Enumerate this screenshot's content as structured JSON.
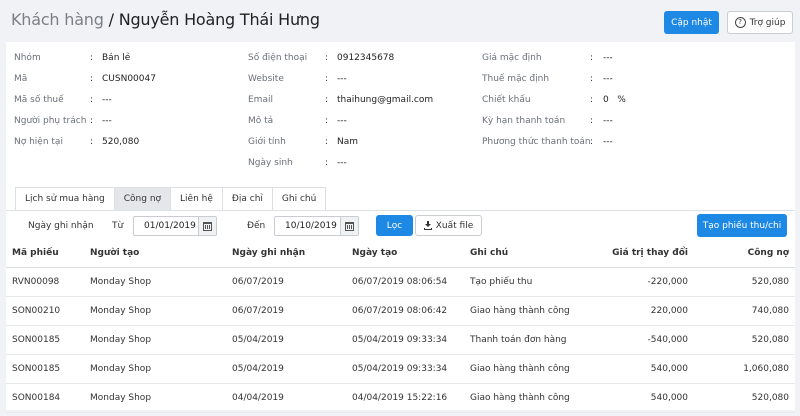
{
  "header": {
    "breadcrumb": "Khách hàng",
    "separator": " / ",
    "customer_name": "Nguyễn Hoàng Thái Hưng",
    "update_label": "Cập nhật",
    "help_label": "Trợ giúp"
  },
  "info": {
    "col1": [
      {
        "label": "Nhóm",
        "value": "Bán lẻ"
      },
      {
        "label": "Mã",
        "value": "CUSN00047"
      },
      {
        "label": "Mã số thuế",
        "value": "---"
      },
      {
        "label": "Người phụ trách",
        "value": "---"
      },
      {
        "label": "Nợ hiện tại",
        "value": "520,080"
      }
    ],
    "col2": [
      {
        "label": "Số điện thoại",
        "value": "0912345678"
      },
      {
        "label": "Website",
        "value": "---"
      },
      {
        "label": "Email",
        "value": "thaihung@gmail.com"
      },
      {
        "label": "Mô tả",
        "value": "---"
      },
      {
        "label": "Giới tính",
        "value": "Nam"
      },
      {
        "label": "Ngày sinh",
        "value": "---"
      }
    ],
    "col3": [
      {
        "label": "Giá mặc định",
        "value": "---"
      },
      {
        "label": "Thuế mặc định",
        "value": "---"
      },
      {
        "label": "Chiết khấu",
        "value": "0   %"
      },
      {
        "label": "Kỳ hạn thanh toán",
        "value": "---"
      },
      {
        "label": "Phương thức thanh toán",
        "value": "---"
      }
    ]
  },
  "tabs": [
    {
      "label": "Lịch sử mua hàng"
    },
    {
      "label": "Công nợ"
    },
    {
      "label": "Liên hệ"
    },
    {
      "label": "Địa chỉ"
    },
    {
      "label": "Ghi chú"
    }
  ],
  "active_tab": "Công nợ",
  "filter": {
    "date_label": "Ngày ghi nhận",
    "from_label": "Từ",
    "from_value": "01/01/2019",
    "to_label": "Đến",
    "to_value": "10/10/2019",
    "filter_button": "Lọc",
    "export_button": "Xuất file",
    "create_button": "Tạo phiếu thu/chi"
  },
  "table": {
    "headers": [
      "Mã phiếu",
      "Người tạo",
      "Ngày ghi nhận",
      "Ngày tạo",
      "Ghi chú",
      "Giá trị thay đổi",
      "Công nợ"
    ],
    "rows": [
      [
        "RVN00098",
        "Monday Shop",
        "06/07/2019",
        "06/07/2019 08:06:54",
        "Tạo phiếu thu",
        "-220,000",
        "520,080"
      ],
      [
        "SON00210",
        "Monday Shop",
        "06/07/2019",
        "06/07/2019 08:06:42",
        "Giao hàng thành công",
        "220,000",
        "740,080"
      ],
      [
        "SON00185",
        "Monday Shop",
        "05/04/2019",
        "05/04/2019 09:33:34",
        "Thanh toán đơn hàng",
        "-540,000",
        "520,080"
      ],
      [
        "SON00185",
        "Monday Shop",
        "05/04/2019",
        "05/04/2019 09:33:34",
        "Giao hàng thành công",
        "540,000",
        "1,060,080"
      ],
      [
        "SON00184",
        "Monday Shop",
        "04/04/2019",
        "04/04/2019 15:22:16",
        "Giao hàng thành công",
        "540,000",
        "520,080"
      ]
    ]
  },
  "colors": {
    "primary": "#1e88e5",
    "background": "#f1f2f6",
    "active_tab": "#e4e6ea"
  }
}
